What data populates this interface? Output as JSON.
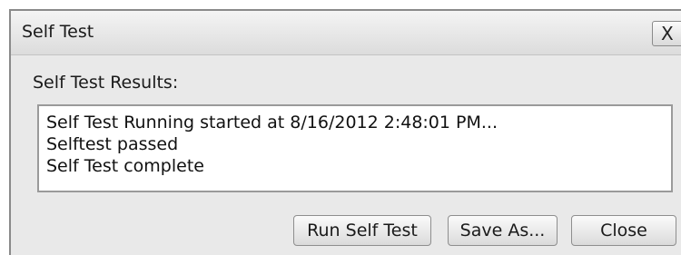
{
  "window": {
    "title": "Self Test",
    "close_glyph": "X"
  },
  "results": {
    "label": "Self Test Results:",
    "lines": [
      "Self Test Running started at 8/16/2012 2:48:01 PM...",
      "Selftest passed",
      "Self Test complete"
    ]
  },
  "buttons": {
    "run": "Run Self Test",
    "save": "Save As...",
    "close": "Close"
  }
}
